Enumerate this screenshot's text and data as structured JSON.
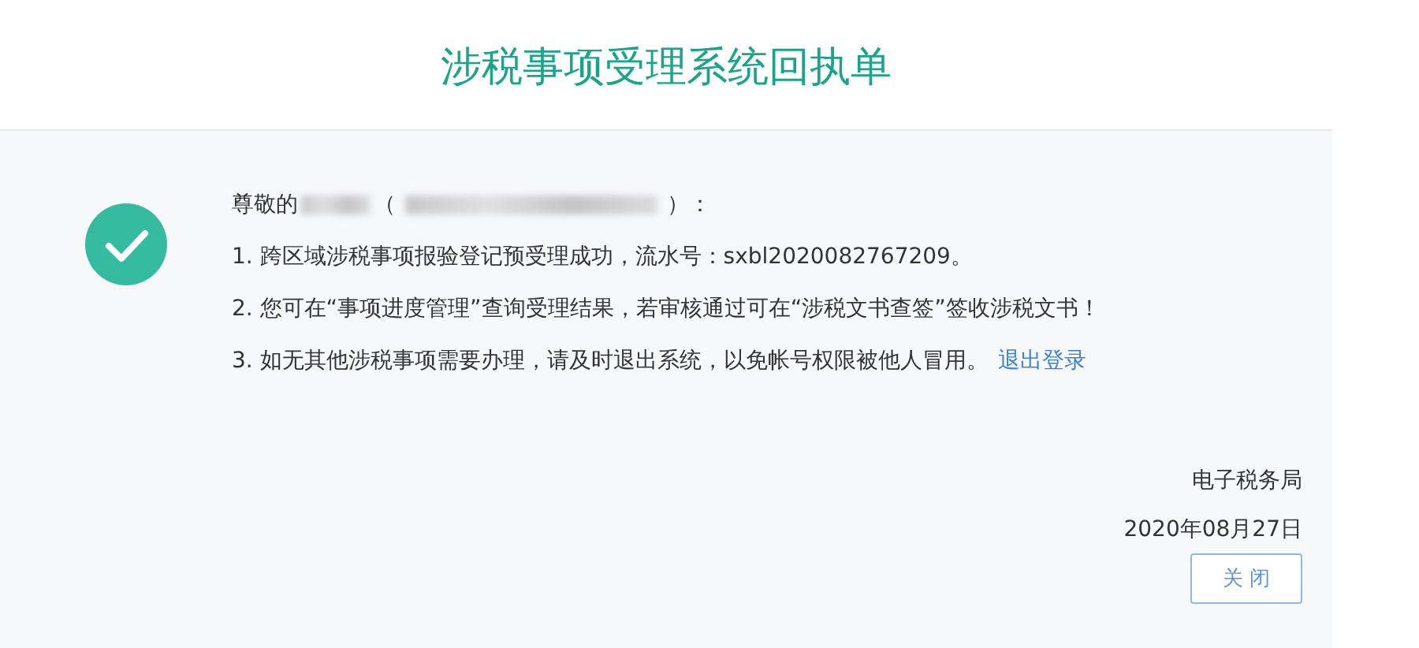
{
  "header": {
    "title": "涉税事项受理系统回执单"
  },
  "receipt": {
    "greeting": {
      "prefix": "尊敬的",
      "open": "（",
      "close": "）："
    },
    "lines": [
      {
        "text": "1. 跨区域涉税事项报验登记预受理成功，流水号：sxbl2020082767209。"
      },
      {
        "text": "2. 您可在“事项进度管理”查询受理结果，若审核通过可在“涉税文书查签”签收涉税文书！"
      },
      {
        "text": "3. 如无其他涉税事项需要办理，请及时退出系统，以免帐号权限被他人冒用。",
        "link": "退出登录"
      }
    ],
    "issuer": "电子税务局",
    "date": "2020年08月27日"
  },
  "buttons": [
    {
      "label": "关 闭"
    }
  ]
}
